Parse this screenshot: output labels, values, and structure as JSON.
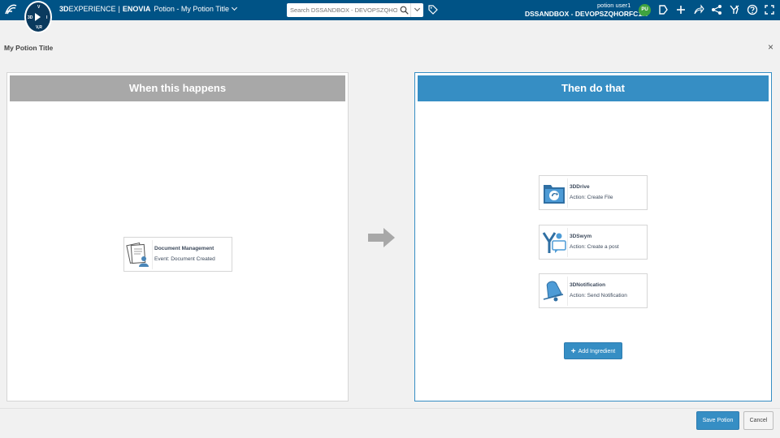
{
  "topbar": {
    "brand_3d": "3D",
    "brand_experience": "EXPERIENCE",
    "brand_sep": "|",
    "brand_enovia": "ENOVIA",
    "app_title": "Potion - My Potion Title",
    "search": {
      "placeholder": "Search DSSANDBOX - DEVOPSZQHORFC1..."
    },
    "user_name": "potion user1",
    "tenant": "DSSANDBOX - DEVOPSZQHORFC1...",
    "avatar_initials": "PU",
    "compass": {
      "north": "V",
      "west": "3D",
      "east": "I",
      "south": "V,R"
    },
    "icons": [
      "tag-icon",
      "bookmark-icon",
      "plus-icon",
      "share-icon",
      "network-icon",
      "collaborate-icon",
      "help-icon",
      "expand-icon"
    ]
  },
  "page": {
    "title": "My Potion Title",
    "close": "×"
  },
  "trigger": {
    "header": "When this happens",
    "card": {
      "title": "Document Management",
      "subtitle": "Event: Document Created",
      "icon": "document-management-icon"
    }
  },
  "actions": {
    "header": "Then do that",
    "cards": [
      {
        "title": "3DDrive",
        "subtitle": "Action: Create File",
        "icon": "3ddrive-icon"
      },
      {
        "title": "3DSwym",
        "subtitle": "Action: Create a post",
        "icon": "3dswym-icon"
      },
      {
        "title": "3DNotification",
        "subtitle": "Action: Send Notification",
        "icon": "3dnotification-icon"
      }
    ],
    "add_label": "Add Ingredient"
  },
  "footer": {
    "save_label": "Save Potion",
    "cancel_label": "Cancel"
  },
  "colors": {
    "topbar": "#005386",
    "accent": "#368ec4",
    "trigger_header": "#a8a8a8"
  }
}
